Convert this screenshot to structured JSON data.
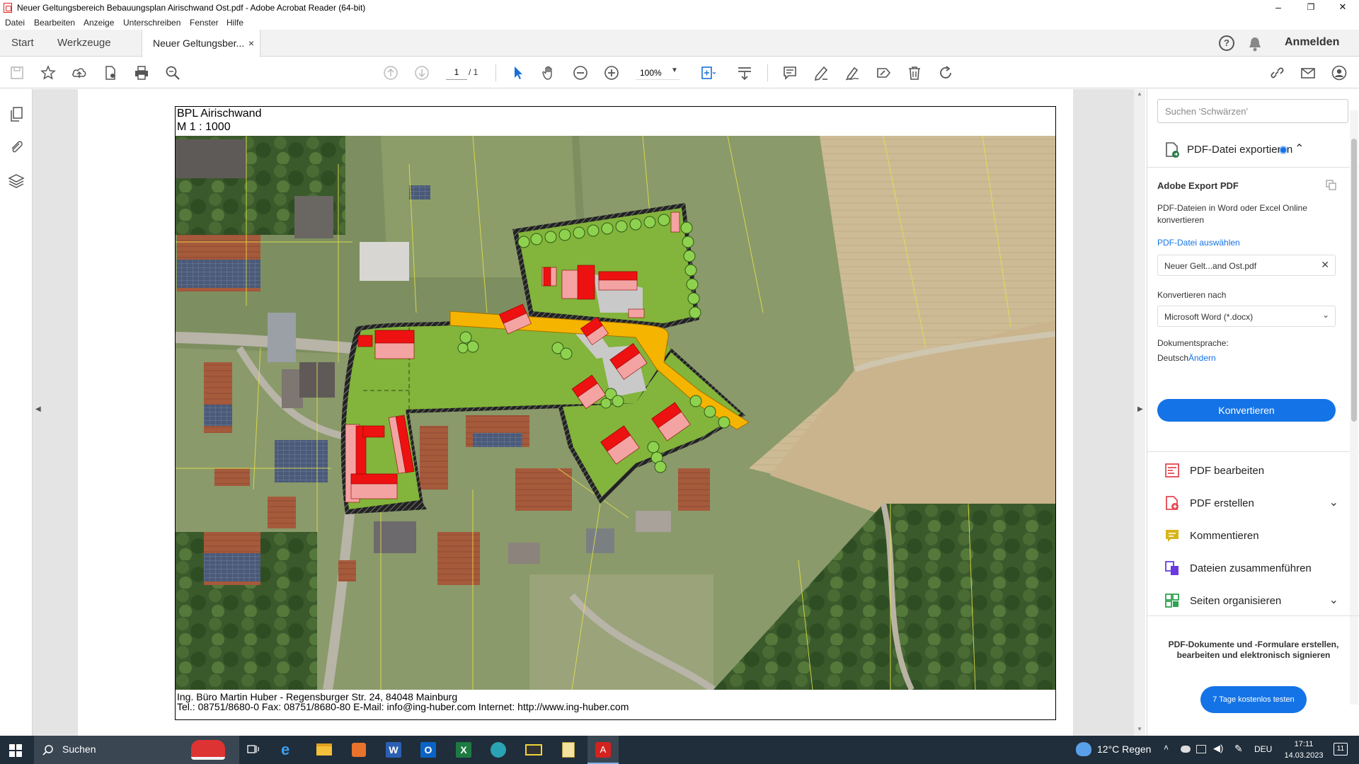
{
  "window": {
    "title": "Neuer Geltungsbereich Bebauungsplan Airischwand Ost.pdf - Adobe Acrobat Reader (64-bit)",
    "minimize": "–",
    "maximize": "❐",
    "close": "✕"
  },
  "menu": [
    "Datei",
    "Bearbeiten",
    "Anzeige",
    "Unterschreiben",
    "Fenster",
    "Hilfe"
  ],
  "tabs": {
    "start": "Start",
    "tools": "Werkzeuge",
    "document": "Neuer Geltungsber...",
    "close": "×",
    "signin": "Anmelden"
  },
  "toolbar": {
    "page_current": "1",
    "page_total": "/  1",
    "zoom": "100%"
  },
  "document": {
    "header_line1": "BPL Airischwand",
    "header_line2": "M 1 : 1000",
    "footer_line1": "Ing. Büro Martin Huber - Regensburger Str. 24, 84048 Mainburg",
    "footer_line2": "Tel.: 08751/8680-0   Fax: 08751/8680-80   E-Mail: info@ing-huber.com   Internet: http://www.ing-huber.com"
  },
  "rightpanel": {
    "search_placeholder": "Suchen 'Schwärzen'",
    "export_title": "PDF-Datei exportieren",
    "service_title": "Adobe Export PDF",
    "service_desc": "PDF-Dateien in Word oder Excel Online konvertieren",
    "select_file": "PDF-Datei auswählen",
    "file_name": "Neuer Gelt...and Ost.pdf",
    "convert_to_label": "Konvertieren nach",
    "convert_to_value": "Microsoft Word (*.docx)",
    "language_label": "Dokumentsprache:",
    "language_value": "Deutsch",
    "language_change": "Ändern",
    "convert_button": "Konvertieren",
    "tools": [
      {
        "label": "PDF bearbeiten",
        "icon": "edit-pdf-icon",
        "color": "#e34850",
        "chevron": false
      },
      {
        "label": "PDF erstellen",
        "icon": "create-pdf-icon",
        "color": "#e34850",
        "chevron": true
      },
      {
        "label": "Kommentieren",
        "icon": "comment-icon",
        "color": "#d7b51a",
        "chevron": false
      },
      {
        "label": "Dateien zusammenführen",
        "icon": "combine-icon",
        "color": "#6a3ae0",
        "chevron": false
      },
      {
        "label": "Seiten organisieren",
        "icon": "organize-icon",
        "color": "#2da44e",
        "chevron": true
      }
    ],
    "promo_text": "PDF-Dokumente und -Formulare erstellen, bearbeiten und elektronisch signieren",
    "promo_button": "7 Tage kostenlos testen"
  },
  "taskbar": {
    "search": "Suchen",
    "weather": "12°C  Regen",
    "language": "DEU",
    "time": "17:11",
    "date": "14.03.2023",
    "notifications": "11"
  },
  "colors": {
    "accent": "#1473e6",
    "plan_green": "#86b53a",
    "road_yellow": "#f5b400",
    "building_red": "#ee1111",
    "building_pink": "#f4a3a3"
  }
}
